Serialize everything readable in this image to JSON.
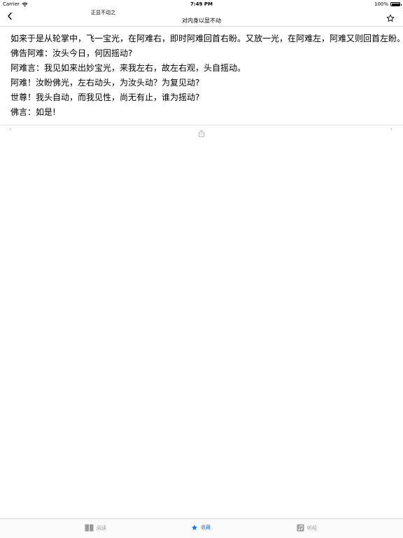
{
  "status_bar": {
    "carrier": "Carrier",
    "time": "7:49 PM",
    "battery": "100%"
  },
  "nav": {
    "subtitle": "正显不动之",
    "title": "对内身以显不动",
    "back_icon": "chevron-left-icon",
    "favorite_icon": "star-outline-icon"
  },
  "content": {
    "lines": [
      "如来于是从轮掌中，飞一宝光，在阿难右，即时阿难回首右盼。又放一光，在阿难左，阿难又则回首左盼。",
      "佛告阿难：汝头今日，何因摇动?",
      "阿难言：我见如来出妙宝光，来我左右，故左右观，头自摇动。",
      "阿难！汝盼佛光，左右动头，为汝头动？为复见动?",
      "世尊！我头自动，而我见性，尚无有止，谁为摇动?",
      "佛言：如是!"
    ]
  },
  "pager": {
    "prev": "‹",
    "next": "›"
  },
  "tabs": [
    {
      "label": "阅读",
      "icon": "book-icon",
      "active": false
    },
    {
      "label": "收藏",
      "icon": "star-filled-icon",
      "active": true
    },
    {
      "label": "听经",
      "icon": "music-note-icon",
      "active": false
    }
  ],
  "colors": {
    "accent": "#1a73e8",
    "inactive": "#999999"
  }
}
